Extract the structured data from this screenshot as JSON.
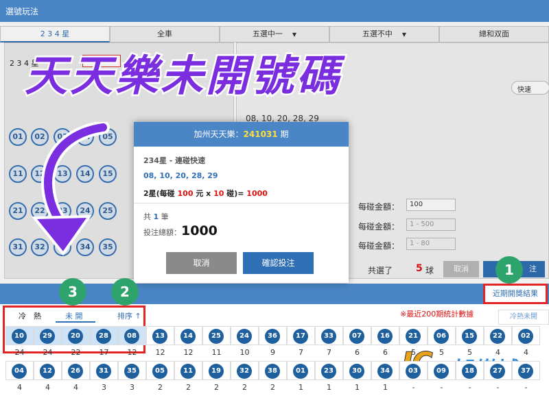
{
  "window_title": "選號玩法",
  "tabs": [
    {
      "label": "2 3 4 星",
      "active": true
    },
    {
      "label": "全車",
      "active": false
    },
    {
      "label": "五選中一",
      "active": false,
      "caret": "▼"
    },
    {
      "label": "五選不中",
      "active": false,
      "caret": "▼"
    },
    {
      "label": "總和双面",
      "active": false
    }
  ],
  "sub": {
    "row_label": "2 3 4 星",
    "mode_button": "連碰快速",
    "mid_label": "中二",
    "speed_select": "快速"
  },
  "left_balls": [
    "01",
    "02",
    "03",
    "04",
    "05",
    "11",
    "12",
    "13",
    "14",
    "15",
    "21",
    "22",
    "23",
    "24",
    "25",
    "31",
    "32",
    "33",
    "34",
    "35"
  ],
  "right_panel": {
    "picked_numbers": "08, 10, 20, 28, 29",
    "amount_label": "每碰金額：",
    "amount_value": "100",
    "amount_ph_1": "1 - 500",
    "amount_ph_2": "1 - 80",
    "selected_prefix": "共選了",
    "selected_count": "5",
    "selected_unit": "球",
    "cancel_label": "取消",
    "confirm_label": "注"
  },
  "dialog": {
    "title_prefix": "加州天天樂：",
    "period": "241031",
    "title_suffix": "期",
    "play_type": "234星 - 連碰快速",
    "numbers": "08, 10, 20, 28, 29",
    "formula_a": "2星(每碰 ",
    "formula_amt": "100",
    "formula_b": " 元 x ",
    "formula_cnt": "10",
    "formula_c": " 碰)= ",
    "formula_total": "1000",
    "count_prefix": "共 ",
    "count_value": "1",
    "count_suffix": " 筆",
    "total_label": "投注總額：",
    "total_value": "1000",
    "cancel": "取消",
    "confirm": "確認投注"
  },
  "overlay_title": "天天樂未開號碼",
  "badges": [
    "1",
    "2",
    "3"
  ],
  "recent_results_button": "近期開獎結果",
  "stats_tabs": {
    "cold": "冷",
    "hot": "熱",
    "unopened": "未 開",
    "sort": "排序 ↑"
  },
  "stats_note": "※最近200期統計數據",
  "hotcold_tab": "冷熱未開",
  "table_row1": {
    "balls": [
      "10",
      "29",
      "20",
      "28",
      "08",
      "13",
      "14",
      "25",
      "24",
      "36",
      "17",
      "33",
      "07",
      "16",
      "21",
      "06",
      "15",
      "22",
      "02"
    ],
    "counts": [
      "24",
      "24",
      "22",
      "17",
      "12",
      "12",
      "12",
      "11",
      "10",
      "9",
      "7",
      "7",
      "6",
      "6",
      "5",
      "5",
      "5",
      "4",
      "4"
    ]
  },
  "table_row2": {
    "balls": [
      "04",
      "12",
      "26",
      "31",
      "35",
      "05",
      "11",
      "19",
      "32",
      "38",
      "01",
      "23",
      "30",
      "34",
      "03",
      "09",
      "18",
      "27",
      "37"
    ],
    "counts": [
      "4",
      "4",
      "4",
      "3",
      "3",
      "2",
      "2",
      "2",
      "2",
      "2",
      "1",
      "1",
      "1",
      "1",
      "-",
      "-",
      "-",
      "-",
      "-"
    ]
  },
  "logo": {
    "jc": "JC",
    "text": "娛樂城"
  },
  "colors": {
    "primary": "#4a85c5",
    "accent_purple": "#7a2ee0",
    "badge_green": "#2ea36b",
    "highlight_red": "#e32424"
  },
  "icons": {
    "arrow": "curved-down-arrow-icon",
    "caret": "chevron-down-icon"
  }
}
